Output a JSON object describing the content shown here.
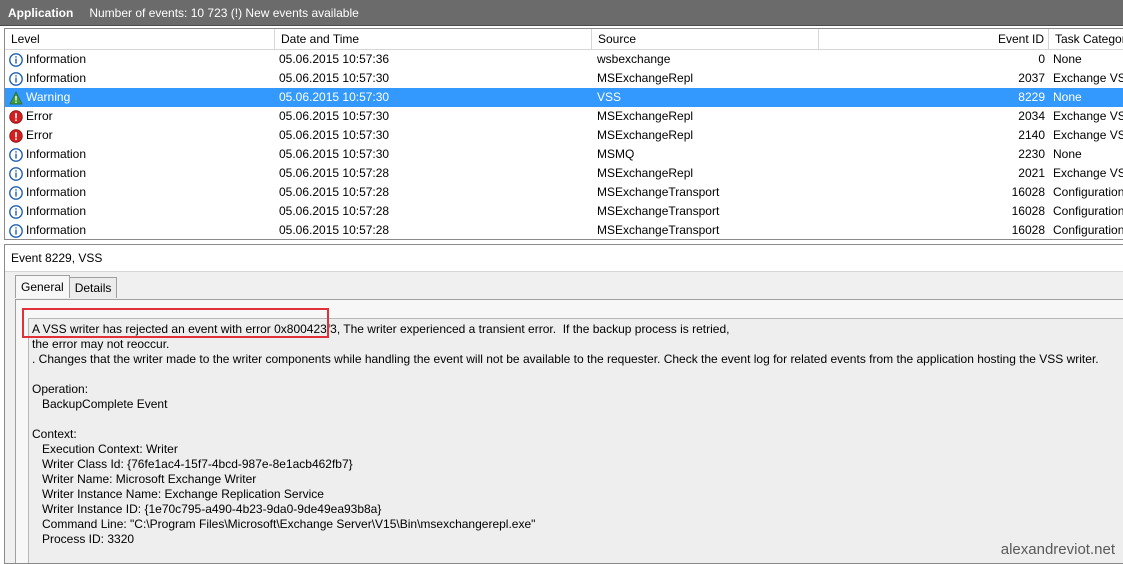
{
  "header": {
    "app": "Application",
    "meta": "Number of events: 10 723 (!) New events available"
  },
  "columns": {
    "level": "Level",
    "date": "Date and Time",
    "source": "Source",
    "event_id": "Event ID",
    "task": "Task Category"
  },
  "events": [
    {
      "level": "Information",
      "icon": "info-icon",
      "date": "05.06.2015 10:57:36",
      "source": "wsbexchange",
      "id": "0",
      "task": "None"
    },
    {
      "level": "Information",
      "icon": "info-icon",
      "date": "05.06.2015 10:57:30",
      "source": "MSExchangeRepl",
      "id": "2037",
      "task": "Exchange VSS"
    },
    {
      "level": "Warning",
      "icon": "warning-icon",
      "date": "05.06.2015 10:57:30",
      "source": "VSS",
      "id": "8229",
      "task": "None"
    },
    {
      "level": "Error",
      "icon": "error-icon",
      "date": "05.06.2015 10:57:30",
      "source": "MSExchangeRepl",
      "id": "2034",
      "task": "Exchange VSS"
    },
    {
      "level": "Error",
      "icon": "error-icon",
      "date": "05.06.2015 10:57:30",
      "source": "MSExchangeRepl",
      "id": "2140",
      "task": "Exchange VSS"
    },
    {
      "level": "Information",
      "icon": "info-icon",
      "date": "05.06.2015 10:57:30",
      "source": "MSMQ",
      "id": "2230",
      "task": "None"
    },
    {
      "level": "Information",
      "icon": "info-icon",
      "date": "05.06.2015 10:57:28",
      "source": "MSExchangeRepl",
      "id": "2021",
      "task": "Exchange VSS"
    },
    {
      "level": "Information",
      "icon": "info-icon",
      "date": "05.06.2015 10:57:28",
      "source": "MSExchangeTransport",
      "id": "16028",
      "task": "Configuration"
    },
    {
      "level": "Information",
      "icon": "info-icon",
      "date": "05.06.2015 10:57:28",
      "source": "MSExchangeTransport",
      "id": "16028",
      "task": "Configuration"
    },
    {
      "level": "Information",
      "icon": "info-icon",
      "date": "05.06.2015 10:57:28",
      "source": "MSExchangeTransport",
      "id": "16028",
      "task": "Configuration"
    }
  ],
  "selected_index": 2,
  "detail": {
    "title": "Event 8229, VSS",
    "tabs": [
      "General",
      "Details"
    ],
    "lines": [
      "A VSS writer has rejected an event with error 0x800423f3, The writer experienced a transient error.  If the backup process is retried,",
      "the error may not reoccur.",
      ". Changes that the writer made to the writer components while handling the event will not be available to the requester. Check the event log for related events from the application hosting the VSS writer.",
      "",
      "Operation:",
      "   BackupComplete Event",
      "",
      "Context:",
      "   Execution Context: Writer",
      "   Writer Class Id: {76fe1ac4-15f7-4bcd-987e-8e1acb462fb7}",
      "   Writer Name: Microsoft Exchange Writer",
      "   Writer Instance Name: Exchange Replication Service",
      "   Writer Instance ID: {1e70c795-a490-4b23-9da0-9de49ea93b8a}",
      "   Command Line: \"C:\\Program Files\\Microsoft\\Exchange Server\\V15\\Bin\\msexchangerepl.exe\"",
      "   Process ID: 3320"
    ]
  },
  "watermark": "alexandreviot.net",
  "colors": {
    "selection": "#3399ff",
    "highlight_box": "#e0303a",
    "info": "#1f5fb3",
    "warning": "#3f9b3f",
    "error": "#d42020"
  }
}
